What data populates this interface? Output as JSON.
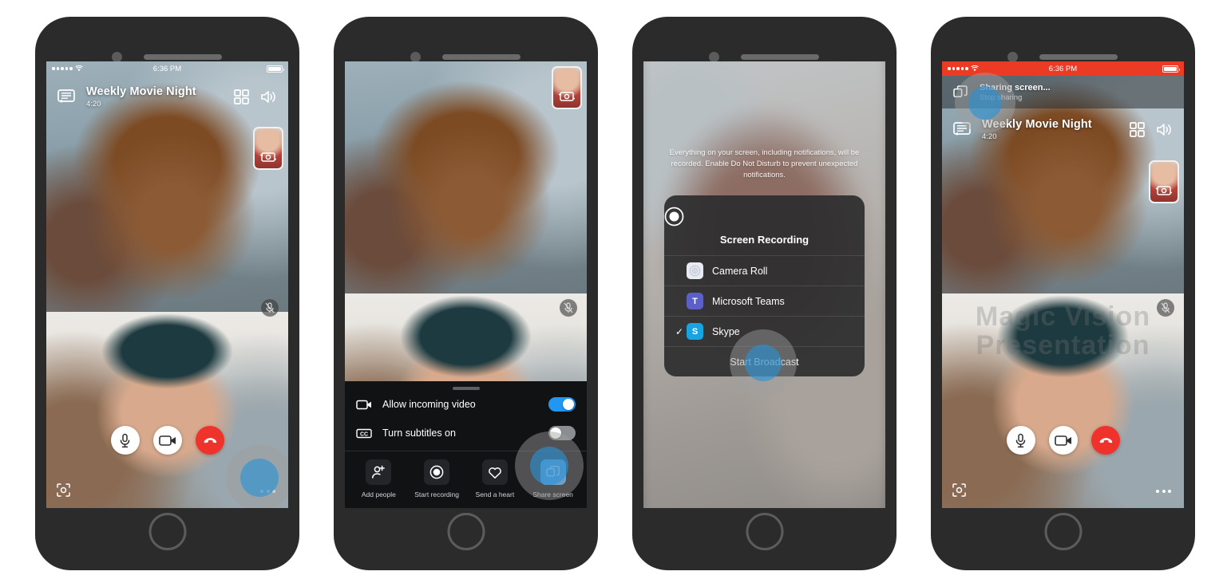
{
  "meta": {
    "background": "#ffffff",
    "accent": "#2196f3",
    "end_call": "#f0322c",
    "recording_red": "#eb3b24"
  },
  "statusbar": {
    "time": "6:36 PM",
    "signal_dots": 5,
    "wifi": "wifi-icon",
    "battery": "battery-icon"
  },
  "phone1": {
    "header": {
      "chat_icon": "chat-bubble-icon",
      "title": "Weekly Movie Night",
      "duration": "4:20",
      "grid_icon": "grid-view-icon",
      "speaker_icon": "speaker-icon"
    },
    "pip": {
      "switch_camera_icon": "switch-camera-icon"
    },
    "mute_badge_icon": "mic-muted-icon",
    "controls": [
      {
        "name": "mic-button",
        "icon": "microphone-icon"
      },
      {
        "name": "video-button",
        "icon": "video-camera-icon"
      },
      {
        "name": "end-call-button",
        "icon": "end-call-icon"
      }
    ],
    "snapshot_icon": "snapshot-icon",
    "more_icon": "more-options-icon"
  },
  "phone2": {
    "pip": {
      "switch_camera_icon": "switch-camera-icon"
    },
    "mute_badge_icon": "mic-muted-icon",
    "sheet": {
      "grabber": "drag-handle",
      "rows": [
        {
          "icon": "video-camera-icon",
          "label": "Allow incoming video",
          "toggle": "on"
        },
        {
          "icon": "closed-caption-icon",
          "label": "Turn subtitles on",
          "toggle": "off"
        }
      ],
      "actions": [
        {
          "icon": "add-person-icon",
          "label": "Add people",
          "highlighted": false
        },
        {
          "icon": "record-icon",
          "label": "Start recording",
          "highlighted": false
        },
        {
          "icon": "heart-icon",
          "label": "Send a heart",
          "highlighted": false
        },
        {
          "icon": "share-screen-icon",
          "label": "Share screen",
          "highlighted": true
        }
      ]
    }
  },
  "phone3": {
    "note": "Everything on your screen, including notifications, will be recorded. Enable Do Not Disturb to prevent unexpected notifications.",
    "dialog": {
      "icon": "record-icon",
      "title": "Screen Recording",
      "options": [
        {
          "icon": "camera-roll-icon",
          "label": "Camera Roll",
          "selected": false,
          "color": "#e8ecf2"
        },
        {
          "icon": "microsoft-teams-icon",
          "label": "Microsoft Teams",
          "selected": false,
          "color": "#5b5fc7"
        },
        {
          "icon": "skype-icon",
          "label": "Skype",
          "selected": true,
          "color": "#18a4e0"
        }
      ],
      "cta": "Start Broadcast"
    }
  },
  "phone4": {
    "sharing_banner": {
      "icon": "share-screen-icon",
      "title": "Sharing screen...",
      "subtitle": "Stop sharing"
    },
    "header": {
      "chat_icon": "chat-bubble-icon",
      "title": "Weekly Movie Night",
      "duration": "4:20",
      "grid_icon": "grid-view-icon",
      "speaker_icon": "speaker-icon"
    },
    "pip": {
      "switch_camera_icon": "switch-camera-icon"
    },
    "mute_badge_icon": "mic-muted-icon",
    "watermark": {
      "line1": "Magic Vision",
      "line2": "Presentation"
    },
    "controls": [
      {
        "name": "mic-button",
        "icon": "microphone-icon"
      },
      {
        "name": "video-button",
        "icon": "video-camera-icon"
      },
      {
        "name": "end-call-button",
        "icon": "end-call-icon"
      }
    ],
    "snapshot_icon": "snapshot-icon",
    "more_icon": "more-options-icon"
  }
}
